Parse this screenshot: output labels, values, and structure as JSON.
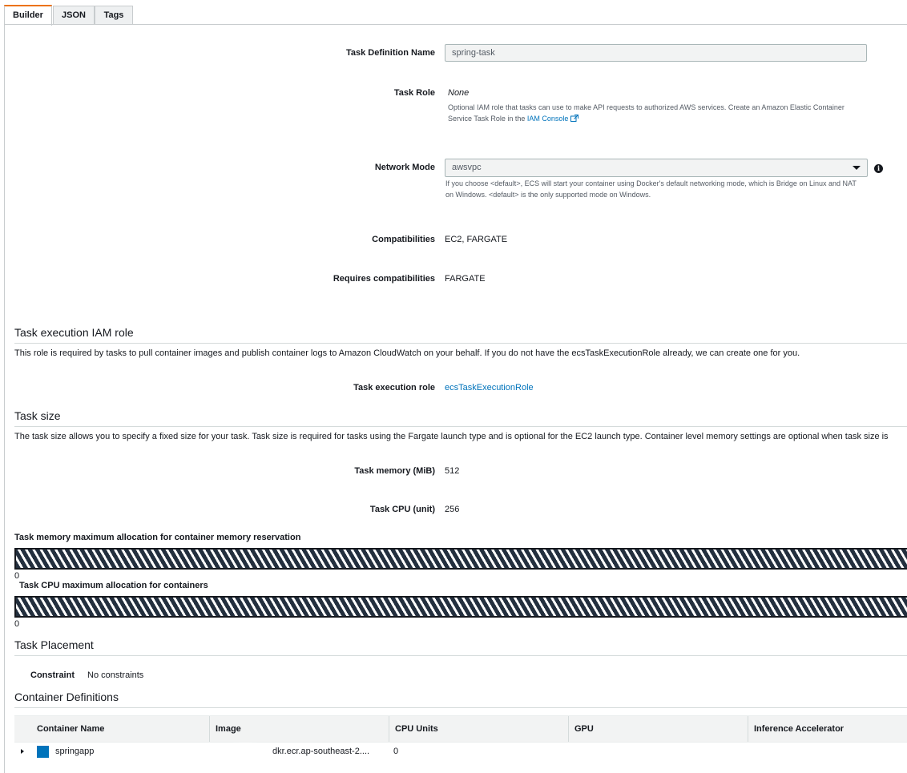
{
  "tabs": [
    {
      "label": "Builder",
      "active": true
    },
    {
      "label": "JSON",
      "active": false
    },
    {
      "label": "Tags",
      "active": false
    }
  ],
  "accent_color": "#ec7211",
  "link_color": "#0073bb",
  "form": {
    "task_definition_name": {
      "label": "Task Definition Name",
      "value": "spring-task"
    },
    "task_role": {
      "label": "Task Role",
      "value": "None",
      "help_text": "Optional IAM role that tasks can use to make API requests to authorized AWS services. Create an Amazon Elastic Container Service Task Role in the",
      "help_link": "IAM Console",
      "external_icon": "external-link-icon"
    },
    "network_mode": {
      "label": "Network Mode",
      "selected": "awsvpc",
      "help_text": "If you choose <default>, ECS will start your container using Docker's default networking mode, which is Bridge on Linux and NAT on Windows. <default> is the only supported mode on Windows.",
      "info_icon": "info-icon"
    },
    "compatibilities": {
      "label": "Compatibilities",
      "value": "EC2, FARGATE"
    },
    "requires_compatibilities": {
      "label": "Requires compatibilities",
      "value": "FARGATE"
    }
  },
  "execution_role": {
    "title": "Task execution IAM role",
    "description": "This role is required by tasks to pull container images and publish container logs to Amazon CloudWatch on your behalf. If you do not have the ecsTaskExecutionRole already, we can create one for you.",
    "label": "Task execution role",
    "value": "ecsTaskExecutionRole"
  },
  "task_size": {
    "title": "Task size",
    "description": "The task size allows you to specify a fixed size for your task. Task size is required for tasks using the Fargate launch type and is optional for the EC2 launch type. Container level memory settings are optional when task size is",
    "memory": {
      "label": "Task memory (MiB)",
      "value": "512"
    },
    "cpu": {
      "label": "Task CPU (unit)",
      "value": "256"
    }
  },
  "allocation": {
    "memory_title": "Task memory maximum allocation for container memory reservation",
    "memory_min": "0",
    "cpu_title": "Task CPU maximum allocation for containers",
    "cpu_min": "0"
  },
  "placement": {
    "title": "Task Placement",
    "label": "Constraint",
    "value": "No constraints"
  },
  "containers": {
    "title": "Container Definitions",
    "columns": [
      "Container Name",
      "Image",
      "CPU Units",
      "GPU",
      "Inference Accelerator"
    ],
    "rows": [
      {
        "name": "springapp",
        "image": "dkr.ecr.ap-southeast-2....",
        "cpu": "0",
        "gpu": "",
        "accelerator": "",
        "color": "#0073bb"
      }
    ]
  }
}
